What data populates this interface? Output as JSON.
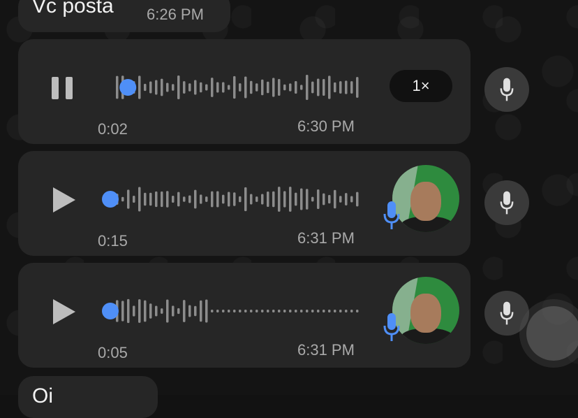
{
  "messages": {
    "top": {
      "text": "Vc posta",
      "time": "6:26 PM"
    },
    "bottom": {
      "text": "Oi"
    }
  },
  "voice_notes": [
    {
      "state": "playing",
      "elapsed": "0:02",
      "time": "6:30 PM",
      "speed": "1×",
      "progress": 0.07
    },
    {
      "state": "paused",
      "elapsed": "0:15",
      "time": "6:31 PM",
      "progress": 0.0
    },
    {
      "state": "paused",
      "elapsed": "0:05",
      "time": "6:31 PM",
      "progress": 0.0
    }
  ],
  "colors": {
    "accent": "#4f8ff7",
    "bubble": "#262626",
    "background": "#141414"
  },
  "icons": [
    "pause-icon",
    "play-icon",
    "mic-icon",
    "mic-badge-icon"
  ]
}
